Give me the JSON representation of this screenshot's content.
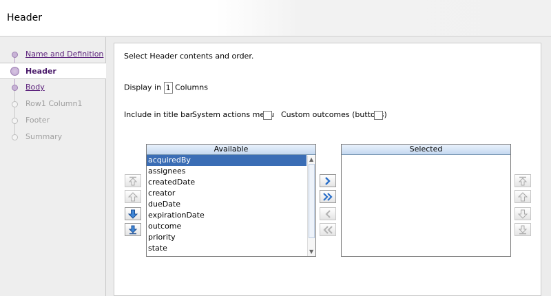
{
  "header": {
    "title": "Header"
  },
  "nav": {
    "items": [
      {
        "label": "Name and Definition",
        "state": "link"
      },
      {
        "label": "Header",
        "state": "selected"
      },
      {
        "label": "Body",
        "state": "link"
      },
      {
        "label": "Row1 Column1",
        "state": "disabled"
      },
      {
        "label": "Footer",
        "state": "disabled"
      },
      {
        "label": "Summary",
        "state": "disabled"
      }
    ]
  },
  "content": {
    "instruction": "Select Header contents and order.",
    "display_in_prefix": "Display in",
    "display_in_value": "1",
    "display_in_suffix": "Columns",
    "include_label": "Include in title bar",
    "system_actions_label": "System actions menu",
    "system_actions_checked": false,
    "custom_outcomes_label": "Custom outcomes (buttons)",
    "custom_outcomes_checked": false
  },
  "available": {
    "header": "Available",
    "items": [
      "acquiredBy",
      "assignees",
      "createdDate",
      "creator",
      "dueDate",
      "expirationDate",
      "outcome",
      "priority",
      "state"
    ],
    "selected_index": 0
  },
  "selected": {
    "header": "Selected",
    "items": []
  },
  "icons": {
    "move_to_top": "move-to-top-icon",
    "move_up": "arrow-up-icon",
    "move_down": "arrow-down-icon",
    "move_to_bottom": "move-to-bottom-icon",
    "move": "chevron-right-icon",
    "move_all": "double-chevron-right-icon",
    "remove": "chevron-left-icon",
    "remove_all": "double-chevron-left-icon"
  },
  "colors": {
    "accent": "#5a1f7a",
    "selection": "#3a6db5",
    "list_header": "#c4d8f0"
  }
}
